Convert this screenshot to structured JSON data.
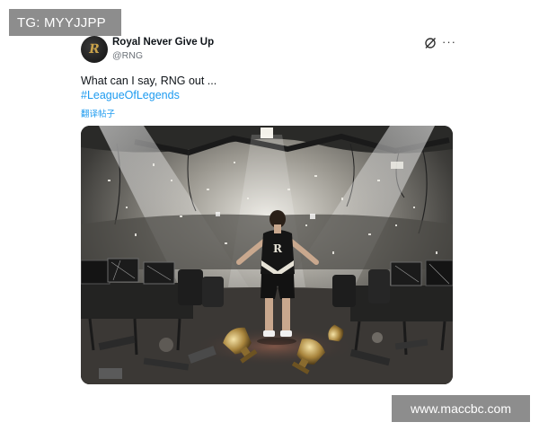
{
  "watermark": {
    "top": "TG: MYYJJPP",
    "bottom": "www.maccbc.com"
  },
  "tweet": {
    "author_name": "Royal Never Give Up",
    "author_handle": "@RNG",
    "avatar_monogram": "R",
    "text": "What can I say, RNG out ...",
    "hashtag": "#LeagueOfLegends",
    "translate_label": "翻译帖子",
    "more_label": "···",
    "jersey_logo": "R"
  },
  "icons": {
    "grok": "grok-icon",
    "more": "more-icon"
  },
  "colors": {
    "link": "#1d9bf0",
    "text": "#0f1419",
    "secondary": "#6b7178",
    "watermark_bg": "#8d8d8d"
  }
}
